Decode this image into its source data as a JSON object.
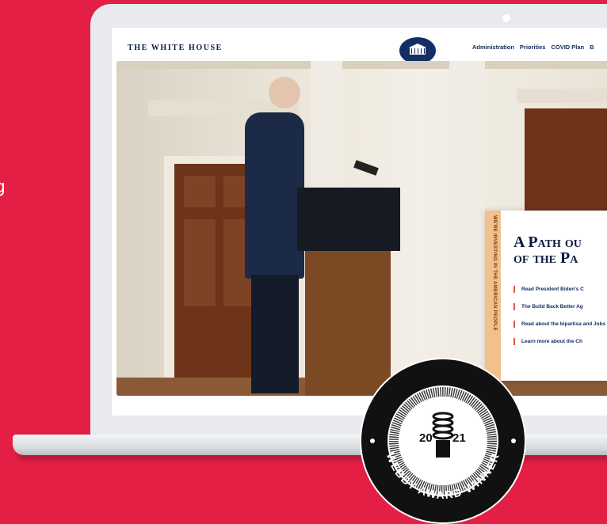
{
  "header": {
    "site_title": "THE WHITE HOUSE",
    "nav": [
      "Administration",
      "Priorities",
      "COVID Plan",
      "B"
    ]
  },
  "card": {
    "tab_text": "WE'RE INVESTING IN THE AMERICAN PEOPLE",
    "title_line1": "A Path ou",
    "title_line2": "of the Pa",
    "links": [
      "Read President Biden's C",
      "The Build Back Better Ag",
      "Read about the bipartisa and Jobs Act",
      "Learn more about the Ch"
    ]
  },
  "badge": {
    "year_left": "20",
    "year_right": "21",
    "text": "WEBBY AWARD WINNER"
  },
  "colors": {
    "background": "#e41f45",
    "navy": "#122e64",
    "accent": "#e2553d",
    "tab": "#f2c08a"
  }
}
